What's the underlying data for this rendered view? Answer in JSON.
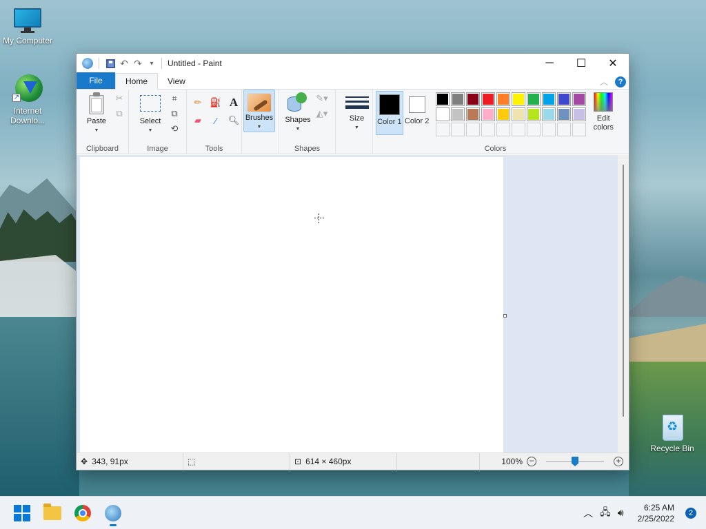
{
  "desktop": {
    "icons": [
      {
        "label": "My Computer"
      },
      {
        "label": "Internet Downlo..."
      },
      {
        "label": "Recycle Bin"
      }
    ]
  },
  "window": {
    "title": "Untitled - Paint",
    "quick_access": [
      "save-icon",
      "undo-icon",
      "redo-icon",
      "customize-chevron-icon"
    ],
    "controls": {
      "minimize": "─",
      "maximize": "☐",
      "close": "✕"
    }
  },
  "ribbon": {
    "tabs": {
      "file": "File",
      "home": "Home",
      "view": "View"
    },
    "clipboard": {
      "paste": "Paste",
      "label": "Clipboard"
    },
    "image": {
      "select": "Select",
      "label": "Image"
    },
    "tools": {
      "label": "Tools"
    },
    "brushes": {
      "label": "Brushes"
    },
    "shapes": {
      "shapes": "Shapes",
      "label": "Shapes"
    },
    "size": {
      "label": "Size"
    },
    "colors": {
      "color1": "Color 1",
      "color2": "Color 2",
      "color1_value": "#000000",
      "color2_value": "#ffffff",
      "edit": "Edit colors",
      "label": "Colors",
      "palette": [
        "#000000",
        "#7f7f7f",
        "#880015",
        "#ed1c24",
        "#ff7f27",
        "#fff200",
        "#22b14c",
        "#00a2e8",
        "#3f48cc",
        "#a349a4",
        "#ffffff",
        "#c3c3c3",
        "#b97a57",
        "#ffaec9",
        "#ffc90e",
        "#efe4b0",
        "#b5e61d",
        "#99d9ea",
        "#7092be",
        "#c8bfe7",
        "",
        "",
        "",
        "",
        "",
        "",
        "",
        "",
        "",
        ""
      ]
    }
  },
  "statusbar": {
    "cursor_pos": "343, 91px",
    "canvas_size": "614 × 460px",
    "zoom": "100%"
  },
  "taskbar": {
    "time": "6:25 AM",
    "date": "2/25/2022",
    "notifications": "2"
  }
}
